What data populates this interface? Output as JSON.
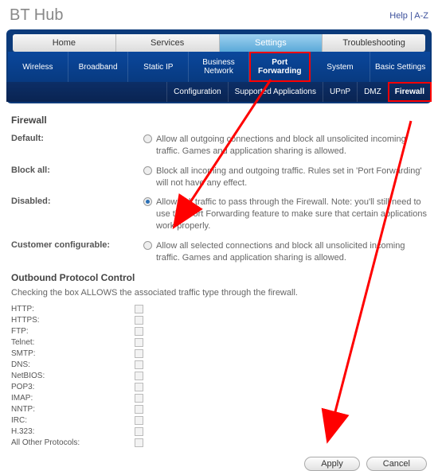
{
  "title": "BT Hub",
  "help": {
    "help": "Help",
    "az": "A-Z"
  },
  "nav1": {
    "home": "Home",
    "services": "Services",
    "settings": "Settings",
    "troubleshooting": "Troubleshooting"
  },
  "nav2": {
    "wireless": "Wireless",
    "broadband": "Broadband",
    "static_ip": "Static IP",
    "business_network": "Business Network",
    "port_forwarding": "Port Forwarding",
    "system": "System",
    "basic_settings": "Basic Settings"
  },
  "nav3": {
    "configuration": "Configuration",
    "supported_applications": "Supported Applications",
    "upnp": "UPnP",
    "dmz": "DMZ",
    "firewall": "Firewall"
  },
  "section_title": "Firewall",
  "options": {
    "default": {
      "label": "Default:",
      "desc": "Allow all outgoing connections and block all unsolicited incoming traffic. Games and application sharing is allowed."
    },
    "block_all": {
      "label": "Block all:",
      "desc": "Block all incoming and outgoing traffic. Rules set in 'Port Forwarding' will not have any effect."
    },
    "disabled": {
      "label": "Disabled:",
      "desc": "Allows all traffic to pass through the Firewall. Note: you'll still need to use the Port Forwarding feature to make sure that certain applications work properly."
    },
    "customer": {
      "label": "Customer configurable:",
      "desc": "Allow all selected connections and block all unsolicited incoming traffic. Games and application sharing is allowed."
    }
  },
  "outbound": {
    "title": "Outbound Protocol Control",
    "desc": "Checking the box ALLOWS the associated traffic type through the firewall.",
    "protocols": [
      "HTTP:",
      "HTTPS:",
      "FTP:",
      "Telnet:",
      "SMTP:",
      "DNS:",
      "NetBIOS:",
      "POP3:",
      "IMAP:",
      "NNTP:",
      "IRC:",
      "H.323:",
      "All Other Protocols:"
    ]
  },
  "actions": {
    "apply": "Apply",
    "cancel": "Cancel"
  }
}
